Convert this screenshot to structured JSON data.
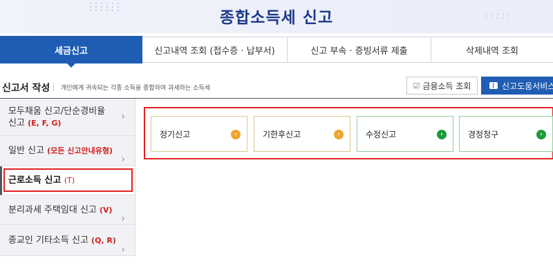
{
  "header": {
    "title": "종합소득세 신고"
  },
  "tabs": [
    {
      "label": "세금신고"
    },
    {
      "label": "신고내역 조회 (접수증 · 납부서)"
    },
    {
      "label": "신고 부속 · 증빙서류 제출"
    },
    {
      "label": "삭제내역 조회"
    }
  ],
  "section": {
    "title": "신고서 작성",
    "description": "개인에게 귀속되는 각종 소득을 종합하여 과세하는 소득세"
  },
  "buttons": {
    "finance": "금융소득 조회",
    "help": "신고도움서비스"
  },
  "sidebar": {
    "items": [
      {
        "label": "모두채움 신고/단순경비율",
        "label2": "신고",
        "code": "(E, F, G)"
      },
      {
        "label": "일반 신고",
        "code": "(모든 신고안내유형)"
      },
      {
        "label": "근로소득 신고",
        "code": "(T)"
      },
      {
        "label": "분리과세 주택임대 신고",
        "code": "(V)"
      },
      {
        "label": "종교인 기타소득 신고",
        "code": "(Q, R)"
      }
    ]
  },
  "cards": [
    {
      "label": "정기신고"
    },
    {
      "label": "기한후신고"
    },
    {
      "label": "수정신고"
    },
    {
      "label": "경정청구"
    }
  ],
  "colors": {
    "primary": "#1e5db3",
    "title": "#1d3a8a",
    "highlight_red": "#e02020",
    "arrow_yellow": "#efa52b",
    "arrow_green": "#1e9a3c"
  }
}
